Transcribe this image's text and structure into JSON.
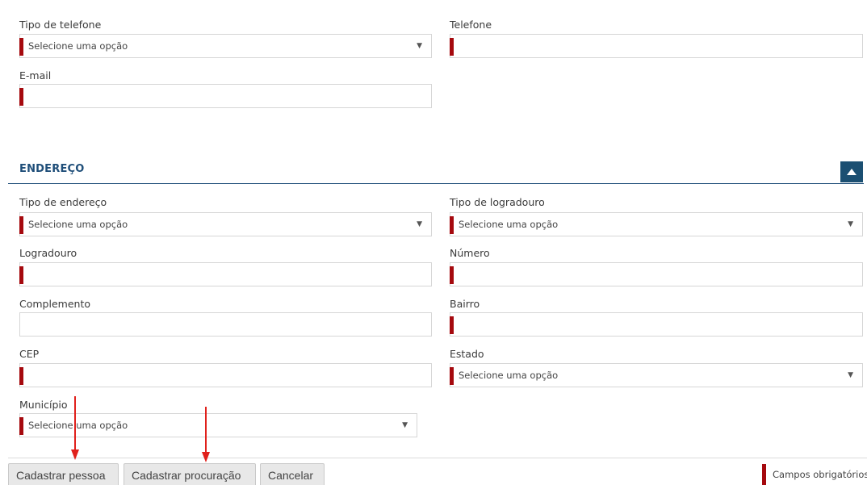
{
  "contact": {
    "phone_type": {
      "label": "Tipo de telefone",
      "value": "Selecione uma opção"
    },
    "phone": {
      "label": "Telefone",
      "value": ""
    },
    "email": {
      "label": "E-mail",
      "value": ""
    }
  },
  "address": {
    "section_title": "ENDEREÇO",
    "address_type": {
      "label": "Tipo de endereço",
      "value": "Selecione uma opção"
    },
    "street_type": {
      "label": "Tipo de logradouro",
      "value": "Selecione uma opção"
    },
    "street": {
      "label": "Logradouro",
      "value": ""
    },
    "number": {
      "label": "Número",
      "value": ""
    },
    "complement": {
      "label": "Complemento",
      "value": ""
    },
    "neighborhood": {
      "label": "Bairro",
      "value": ""
    },
    "cep": {
      "label": "CEP",
      "value": ""
    },
    "state": {
      "label": "Estado",
      "value": "Selecione uma opção"
    },
    "city": {
      "label": "Município",
      "value": "Selecione uma opção"
    }
  },
  "footer": {
    "buttons": [
      "Cadastrar pessoa",
      "Cadastrar procuração",
      "Cancelar"
    ],
    "legend": "Campos obrigatórios"
  },
  "colors": {
    "required_marker": "#a5090e",
    "section_accent": "#1f4e79",
    "annotation_arrow": "#e0201b"
  },
  "icons": {
    "dropdown": "caret-down-icon",
    "collapse": "caret-up-icon",
    "annotation": "red-arrow-icon"
  }
}
